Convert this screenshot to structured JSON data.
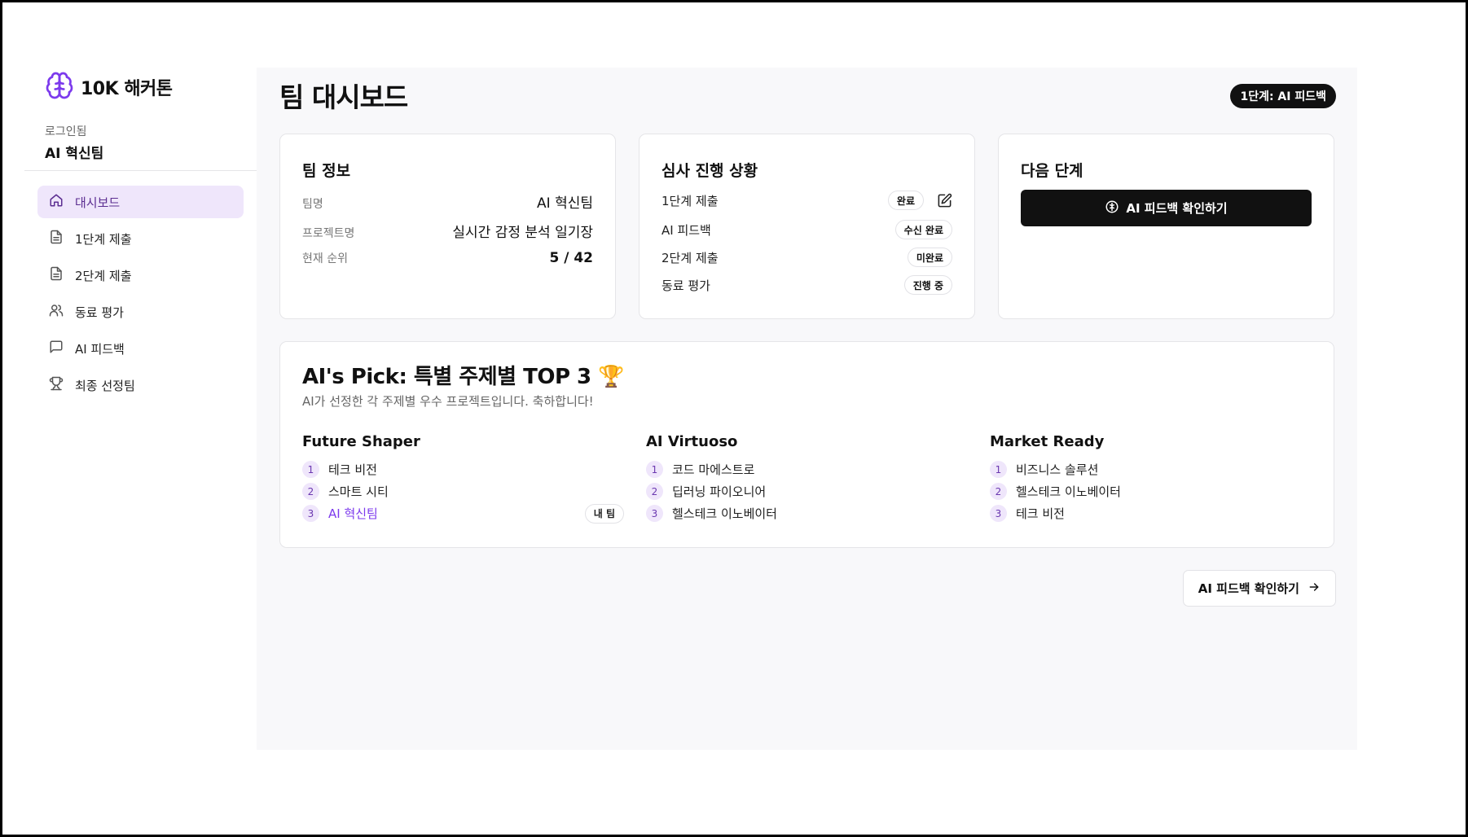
{
  "brand": {
    "name": "10K 해커톤",
    "accent": "#7c3aed"
  },
  "user": {
    "caption": "로그인됨",
    "team": "AI 혁신팀"
  },
  "nav": [
    {
      "label": "대시보드",
      "icon": "home-icon",
      "active": true
    },
    {
      "label": "1단계 제출",
      "icon": "document-icon"
    },
    {
      "label": "2단계 제출",
      "icon": "document-icon"
    },
    {
      "label": "동료 평가",
      "icon": "users-icon"
    },
    {
      "label": "AI 피드백",
      "icon": "message-icon"
    },
    {
      "label": "최종 선정팀",
      "icon": "trophy-icon"
    }
  ],
  "header": {
    "title": "팀 대시보드",
    "stage_badge": "1단계: AI 피드백"
  },
  "team_info": {
    "title": "팀 정보",
    "rows": [
      {
        "key": "팀명",
        "value": "AI 혁신팀"
      },
      {
        "key": "프로젝트명",
        "value": "실시간 감정 분석 일기장"
      },
      {
        "key": "현재 순위",
        "value": "5 / 42"
      }
    ]
  },
  "progress": {
    "title": "심사 진행 상황",
    "rows": [
      {
        "label": "1단계 제출",
        "status": "완료"
      },
      {
        "label": "AI 피드백",
        "status": "수신 완료"
      },
      {
        "label": "2단계 제출",
        "status": "미완료"
      },
      {
        "label": "동료 평가",
        "status": "진행 중"
      }
    ]
  },
  "next_step": {
    "title": "다음 단계",
    "button": "AI 피드백 확인하기"
  },
  "picks": {
    "title": "AI's Pick: 특별 주제별 TOP 3 🏆",
    "subtitle": "AI가 선정한 각 주제별 우수 프로젝트입니다. 축하합니다!",
    "my_team_badge": "내 팀",
    "categories": [
      {
        "name": "Future Shaper",
        "teams": [
          {
            "rank": "1",
            "name": "테크 비전"
          },
          {
            "rank": "2",
            "name": "스마트 시티"
          },
          {
            "rank": "3",
            "name": "AI 혁신팀"
          }
        ]
      },
      {
        "name": "AI Virtuoso",
        "teams": [
          {
            "rank": "1",
            "name": "코드 마에스트로"
          },
          {
            "rank": "2",
            "name": "딥러닝 파이오니어"
          },
          {
            "rank": "3",
            "name": "헬스테크 이노베이터"
          }
        ]
      },
      {
        "name": "Market Ready",
        "teams": [
          {
            "rank": "1",
            "name": "비즈니스 솔루션"
          },
          {
            "rank": "2",
            "name": "헬스테크 이노베이터"
          },
          {
            "rank": "3",
            "name": "테크 비전"
          }
        ]
      }
    ]
  },
  "footer_button": "AI 피드백 확인하기"
}
